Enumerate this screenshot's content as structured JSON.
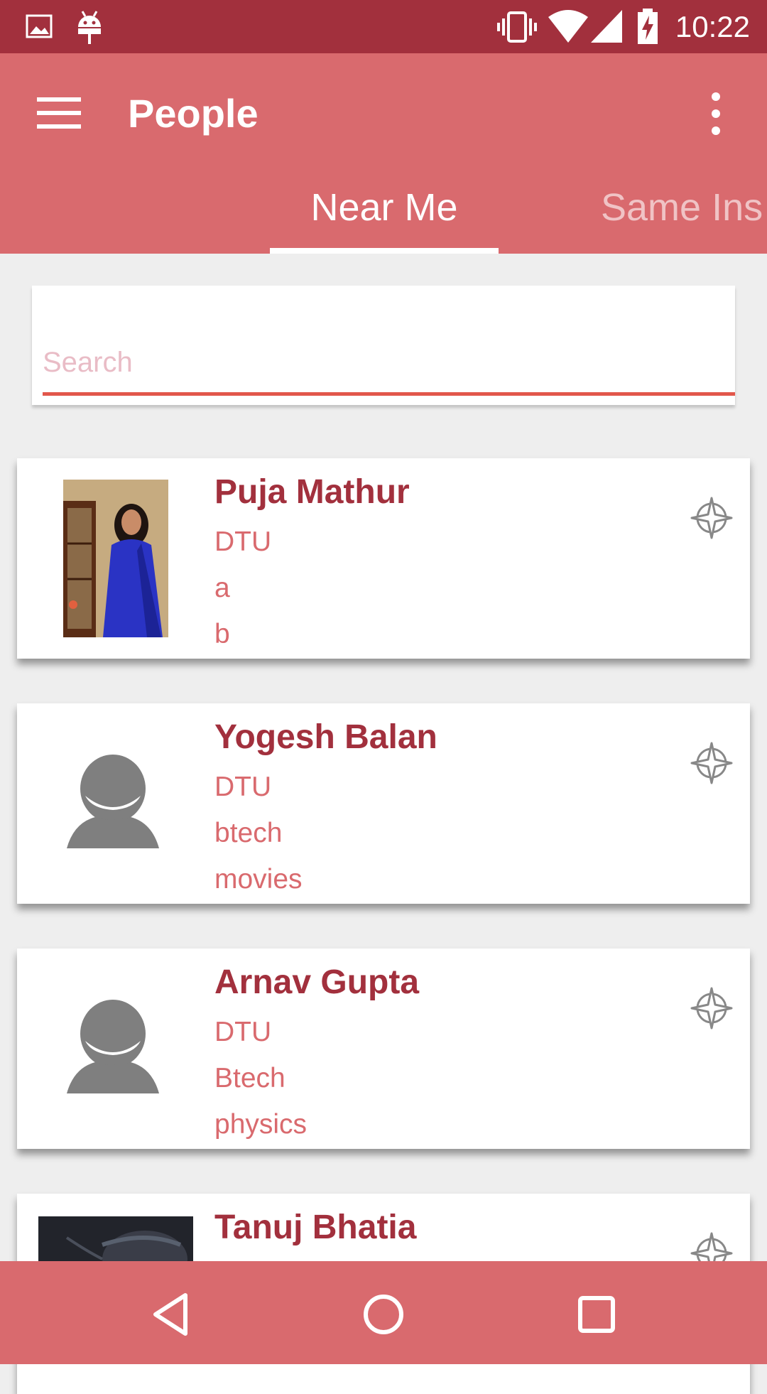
{
  "status_bar": {
    "time": "10:22",
    "icons": [
      "image-icon",
      "android-icon",
      "vibrate-icon",
      "wifi-icon",
      "signal-icon",
      "battery-charging-icon"
    ]
  },
  "app_bar": {
    "title": "People",
    "menu_icon": "hamburger-menu-icon",
    "overflow_icon": "more-vert-icon"
  },
  "tabs": [
    {
      "label": "Near Me",
      "selected": true
    },
    {
      "label": "Same Ins",
      "selected": false
    }
  ],
  "search": {
    "placeholder": "Search",
    "value": "",
    "accent": "#e2574b"
  },
  "people": [
    {
      "name": "Puja Mathur",
      "institute": "DTU",
      "line2": "a",
      "line3": "b",
      "avatar": "photo"
    },
    {
      "name": "Yogesh Balan",
      "institute": "DTU",
      "line2": "btech",
      "line3": "movies",
      "avatar": "default-avatar-icon"
    },
    {
      "name": "Arnav Gupta",
      "institute": "DTU",
      "line2": "Btech",
      "line3": "physics",
      "avatar": "default-avatar-icon"
    },
    {
      "name": "Tanuj Bhatia",
      "institute": "",
      "line2": "",
      "line3": "",
      "avatar": "photo"
    }
  ],
  "nav_bar": {
    "buttons": [
      "back-icon",
      "home-icon",
      "recents-icon"
    ]
  },
  "colors": {
    "status_bar": "#a2303d",
    "primary": "#d96a6e",
    "name_text": "#a2303d",
    "detail_text": "#d96a6e",
    "background": "#eeeeee"
  }
}
